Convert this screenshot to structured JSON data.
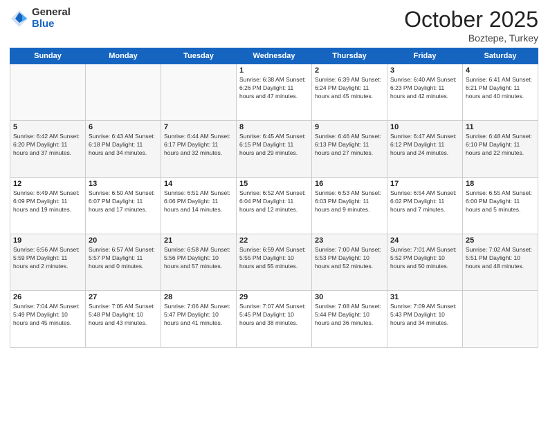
{
  "header": {
    "logo_general": "General",
    "logo_blue": "Blue",
    "month_year": "October 2025",
    "location": "Boztepe, Turkey"
  },
  "days_of_week": [
    "Sunday",
    "Monday",
    "Tuesday",
    "Wednesday",
    "Thursday",
    "Friday",
    "Saturday"
  ],
  "weeks": [
    [
      {
        "day": "",
        "info": ""
      },
      {
        "day": "",
        "info": ""
      },
      {
        "day": "",
        "info": ""
      },
      {
        "day": "1",
        "info": "Sunrise: 6:38 AM\nSunset: 6:26 PM\nDaylight: 11 hours\nand 47 minutes."
      },
      {
        "day": "2",
        "info": "Sunrise: 6:39 AM\nSunset: 6:24 PM\nDaylight: 11 hours\nand 45 minutes."
      },
      {
        "day": "3",
        "info": "Sunrise: 6:40 AM\nSunset: 6:23 PM\nDaylight: 11 hours\nand 42 minutes."
      },
      {
        "day": "4",
        "info": "Sunrise: 6:41 AM\nSunset: 6:21 PM\nDaylight: 11 hours\nand 40 minutes."
      }
    ],
    [
      {
        "day": "5",
        "info": "Sunrise: 6:42 AM\nSunset: 6:20 PM\nDaylight: 11 hours\nand 37 minutes."
      },
      {
        "day": "6",
        "info": "Sunrise: 6:43 AM\nSunset: 6:18 PM\nDaylight: 11 hours\nand 34 minutes."
      },
      {
        "day": "7",
        "info": "Sunrise: 6:44 AM\nSunset: 6:17 PM\nDaylight: 11 hours\nand 32 minutes."
      },
      {
        "day": "8",
        "info": "Sunrise: 6:45 AM\nSunset: 6:15 PM\nDaylight: 11 hours\nand 29 minutes."
      },
      {
        "day": "9",
        "info": "Sunrise: 6:46 AM\nSunset: 6:13 PM\nDaylight: 11 hours\nand 27 minutes."
      },
      {
        "day": "10",
        "info": "Sunrise: 6:47 AM\nSunset: 6:12 PM\nDaylight: 11 hours\nand 24 minutes."
      },
      {
        "day": "11",
        "info": "Sunrise: 6:48 AM\nSunset: 6:10 PM\nDaylight: 11 hours\nand 22 minutes."
      }
    ],
    [
      {
        "day": "12",
        "info": "Sunrise: 6:49 AM\nSunset: 6:09 PM\nDaylight: 11 hours\nand 19 minutes."
      },
      {
        "day": "13",
        "info": "Sunrise: 6:50 AM\nSunset: 6:07 PM\nDaylight: 11 hours\nand 17 minutes."
      },
      {
        "day": "14",
        "info": "Sunrise: 6:51 AM\nSunset: 6:06 PM\nDaylight: 11 hours\nand 14 minutes."
      },
      {
        "day": "15",
        "info": "Sunrise: 6:52 AM\nSunset: 6:04 PM\nDaylight: 11 hours\nand 12 minutes."
      },
      {
        "day": "16",
        "info": "Sunrise: 6:53 AM\nSunset: 6:03 PM\nDaylight: 11 hours\nand 9 minutes."
      },
      {
        "day": "17",
        "info": "Sunrise: 6:54 AM\nSunset: 6:02 PM\nDaylight: 11 hours\nand 7 minutes."
      },
      {
        "day": "18",
        "info": "Sunrise: 6:55 AM\nSunset: 6:00 PM\nDaylight: 11 hours\nand 5 minutes."
      }
    ],
    [
      {
        "day": "19",
        "info": "Sunrise: 6:56 AM\nSunset: 5:59 PM\nDaylight: 11 hours\nand 2 minutes."
      },
      {
        "day": "20",
        "info": "Sunrise: 6:57 AM\nSunset: 5:57 PM\nDaylight: 11 hours\nand 0 minutes."
      },
      {
        "day": "21",
        "info": "Sunrise: 6:58 AM\nSunset: 5:56 PM\nDaylight: 10 hours\nand 57 minutes."
      },
      {
        "day": "22",
        "info": "Sunrise: 6:59 AM\nSunset: 5:55 PM\nDaylight: 10 hours\nand 55 minutes."
      },
      {
        "day": "23",
        "info": "Sunrise: 7:00 AM\nSunset: 5:53 PM\nDaylight: 10 hours\nand 52 minutes."
      },
      {
        "day": "24",
        "info": "Sunrise: 7:01 AM\nSunset: 5:52 PM\nDaylight: 10 hours\nand 50 minutes."
      },
      {
        "day": "25",
        "info": "Sunrise: 7:02 AM\nSunset: 5:51 PM\nDaylight: 10 hours\nand 48 minutes."
      }
    ],
    [
      {
        "day": "26",
        "info": "Sunrise: 7:04 AM\nSunset: 5:49 PM\nDaylight: 10 hours\nand 45 minutes."
      },
      {
        "day": "27",
        "info": "Sunrise: 7:05 AM\nSunset: 5:48 PM\nDaylight: 10 hours\nand 43 minutes."
      },
      {
        "day": "28",
        "info": "Sunrise: 7:06 AM\nSunset: 5:47 PM\nDaylight: 10 hours\nand 41 minutes."
      },
      {
        "day": "29",
        "info": "Sunrise: 7:07 AM\nSunset: 5:45 PM\nDaylight: 10 hours\nand 38 minutes."
      },
      {
        "day": "30",
        "info": "Sunrise: 7:08 AM\nSunset: 5:44 PM\nDaylight: 10 hours\nand 36 minutes."
      },
      {
        "day": "31",
        "info": "Sunrise: 7:09 AM\nSunset: 5:43 PM\nDaylight: 10 hours\nand 34 minutes."
      },
      {
        "day": "",
        "info": ""
      }
    ]
  ]
}
